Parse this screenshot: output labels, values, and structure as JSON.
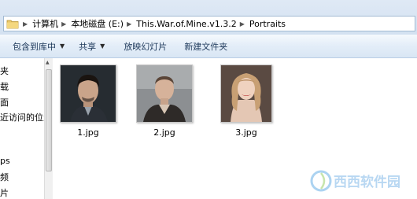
{
  "address": {
    "breadcrumbs": [
      "计算机",
      "本地磁盘 (E:)",
      "This.War.of.Mine.v1.3.2",
      "Portraits"
    ]
  },
  "toolbar": {
    "include_label": "包含到库中",
    "share_label": "共享",
    "slideshow_label": "放映幻灯片",
    "new_folder_label": "新建文件夹"
  },
  "nav": {
    "items": [
      "夹",
      "载",
      "面",
      "近访问的位置",
      "ps",
      "频",
      "片"
    ]
  },
  "files": [
    {
      "name": "1.jpg"
    },
    {
      "name": "2.jpg"
    },
    {
      "name": "3.jpg"
    }
  ],
  "watermark": {
    "text": "西西软件园"
  }
}
